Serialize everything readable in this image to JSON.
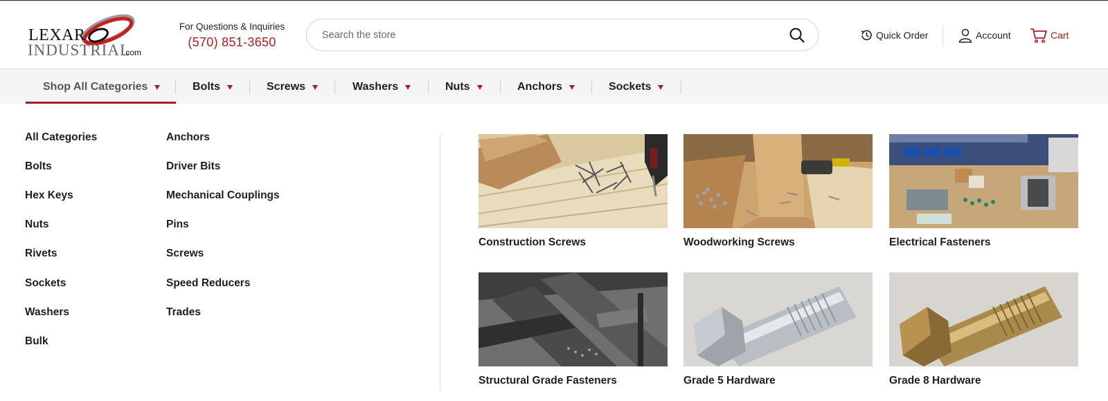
{
  "header": {
    "logo": {
      "line1": "LEXAR",
      "line2": "INDUSTRIAL",
      "suffix": ".com"
    },
    "contact": {
      "label": "For Questions & Inquiries",
      "phone": "(570) 851-3650"
    },
    "search": {
      "placeholder": "Search the store"
    },
    "utility": {
      "quick_order": "Quick Order",
      "account": "Account",
      "cart": "Cart"
    }
  },
  "nav": {
    "items": [
      {
        "label": "Shop All Categories"
      },
      {
        "label": "Bolts"
      },
      {
        "label": "Screws"
      },
      {
        "label": "Washers"
      },
      {
        "label": "Nuts"
      },
      {
        "label": "Anchors"
      },
      {
        "label": "Sockets"
      }
    ]
  },
  "menu": {
    "col1": [
      "All Categories",
      "Bolts",
      "Hex Keys",
      "Nuts",
      "Rivets",
      "Sockets",
      "Washers",
      "Bulk"
    ],
    "col2": [
      "Anchors",
      "Driver Bits",
      "Mechanical Couplings",
      "Pins",
      "Screws",
      "Speed Reducers",
      "Trades"
    ]
  },
  "featured": [
    {
      "title": "Construction Screws",
      "image": "construction-screws-photo"
    },
    {
      "title": "Woodworking Screws",
      "image": "woodworking-screws-photo"
    },
    {
      "title": "Electrical Fasteners",
      "image": "electrical-fasteners-photo"
    },
    {
      "title": "Structural Grade Fasteners",
      "image": "structural-steel-photo"
    },
    {
      "title": "Grade 5 Hardware",
      "image": "grade5-bolt-photo"
    },
    {
      "title": "Grade 8 Hardware",
      "image": "grade8-bolt-photo"
    }
  ],
  "colors": {
    "accent": "#b01c1c",
    "nav_bg": "#f5f5f5",
    "text": "#1e1e1e"
  }
}
